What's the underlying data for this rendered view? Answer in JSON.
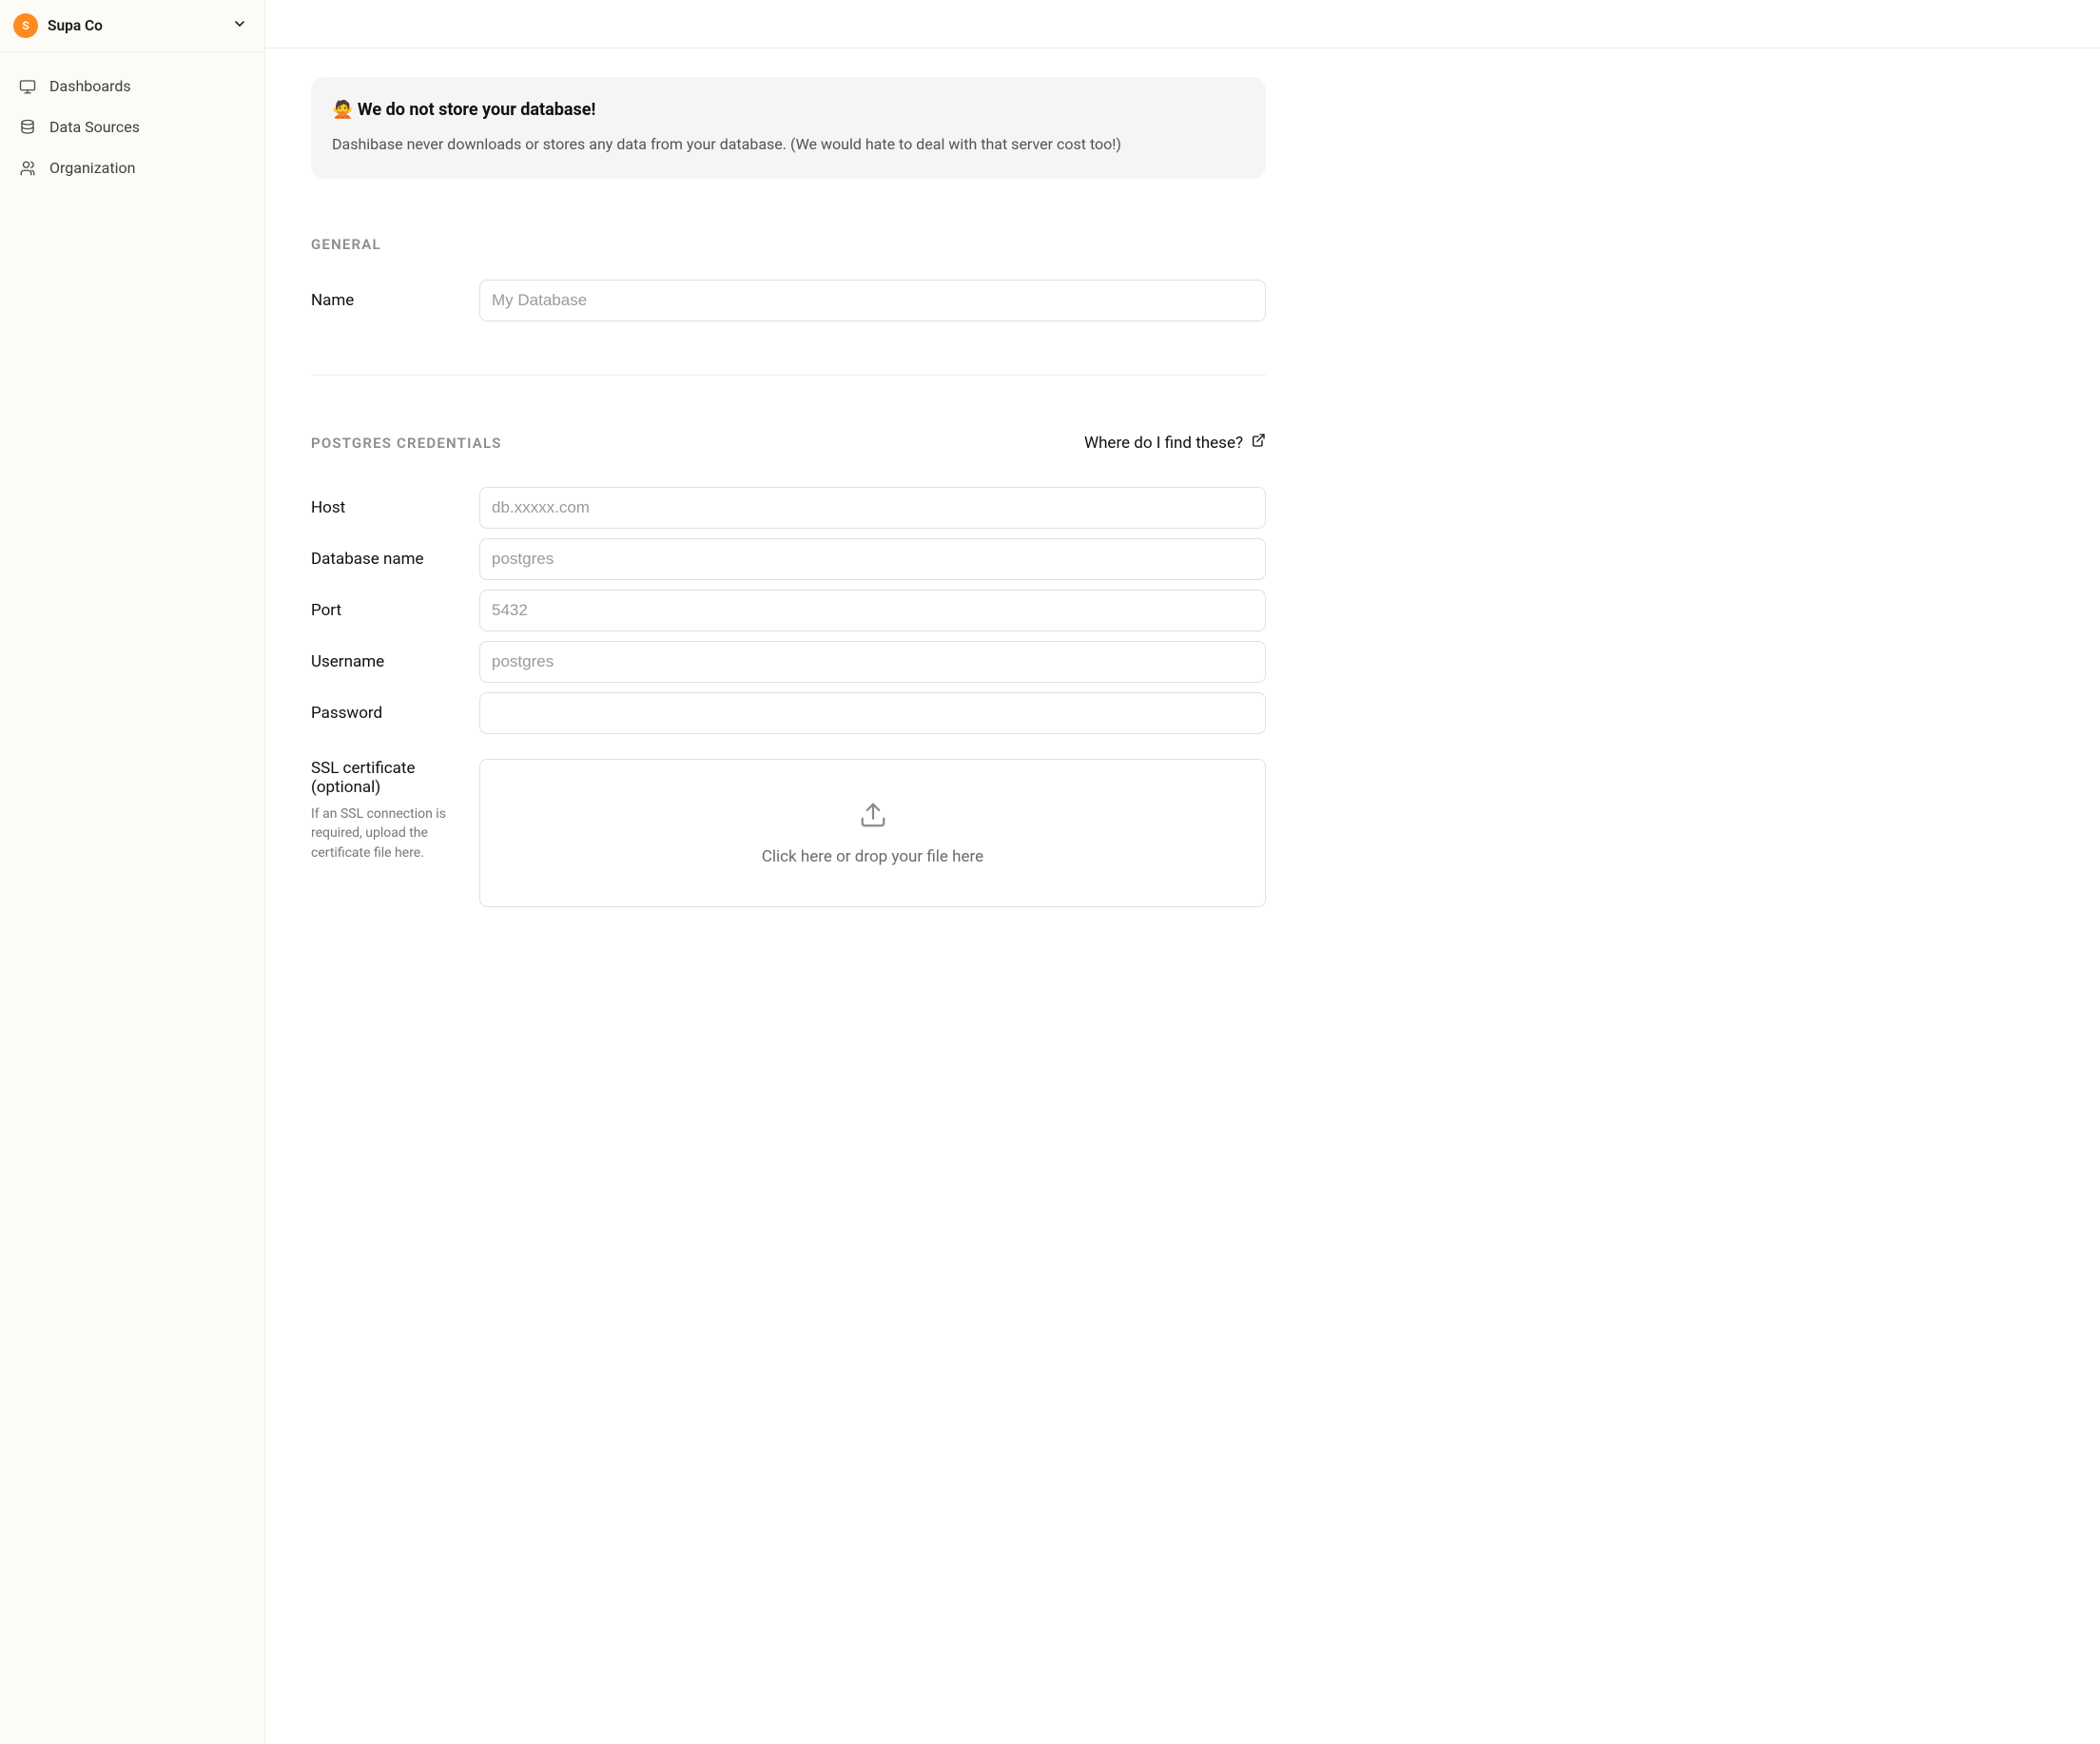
{
  "org": {
    "avatar_letter": "S",
    "name": "Supa Co"
  },
  "sidebar": {
    "items": [
      {
        "label": "Dashboards"
      },
      {
        "label": "Data Sources"
      },
      {
        "label": "Organization"
      }
    ]
  },
  "notice": {
    "emoji": "🙅",
    "title": "We do not store your database!",
    "body": "Dashibase never downloads or stores any data from your database. (We would hate to deal with that server cost too!)"
  },
  "general": {
    "section_title": "General",
    "name_label": "Name",
    "name_placeholder": "My Database",
    "name_value": ""
  },
  "postgres": {
    "section_title": "Postgres Credentials",
    "help_label": "Where do I find these?",
    "host_label": "Host",
    "host_placeholder": "db.xxxxx.com",
    "host_value": "",
    "dbname_label": "Database name",
    "dbname_placeholder": "postgres",
    "dbname_value": "",
    "port_label": "Port",
    "port_placeholder": "5432",
    "port_value": "",
    "username_label": "Username",
    "username_placeholder": "postgres",
    "username_value": "",
    "password_label": "Password",
    "password_placeholder": "",
    "password_value": "",
    "ssl_label": "SSL certificate (optional)",
    "ssl_sub": "If an SSL connection is required, upload the certificate file here.",
    "upload_text": "Click here or drop your file here"
  },
  "colors": {
    "accent": "#ff8b1f"
  }
}
